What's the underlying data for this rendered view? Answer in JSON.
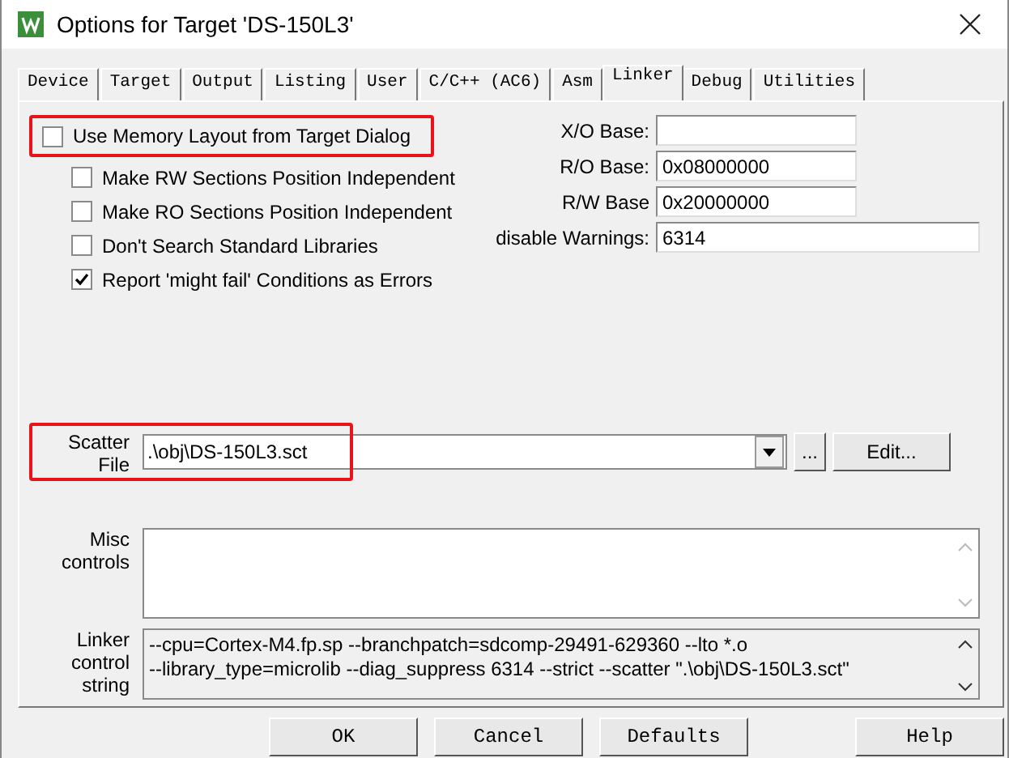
{
  "window": {
    "title": "Options for Target 'DS-150L3'"
  },
  "tabs": [
    {
      "label": "Device",
      "selected": false
    },
    {
      "label": "Target",
      "selected": false
    },
    {
      "label": "Output",
      "selected": false
    },
    {
      "label": "Listing",
      "selected": false
    },
    {
      "label": "User",
      "selected": false
    },
    {
      "label": "C/C++ (AC6)",
      "selected": false
    },
    {
      "label": "Asm",
      "selected": false
    },
    {
      "label": "Linker",
      "selected": true
    },
    {
      "label": "Debug",
      "selected": false
    },
    {
      "label": "Utilities",
      "selected": false
    }
  ],
  "options": [
    {
      "label": "Use Memory Layout from Target Dialog",
      "checked": false,
      "highlighted": true,
      "kind": "main"
    },
    {
      "label": "Make RW Sections Position Independent",
      "checked": false,
      "highlighted": false,
      "kind": "sub"
    },
    {
      "label": "Make RO Sections Position Independent",
      "checked": false,
      "highlighted": false,
      "kind": "sub"
    },
    {
      "label": "Don't Search Standard Libraries",
      "checked": false,
      "highlighted": false,
      "kind": "sub"
    },
    {
      "label": "Report 'might fail' Conditions as Errors",
      "checked": true,
      "highlighted": false,
      "kind": "sub"
    }
  ],
  "bases": [
    {
      "label": "X/O Base:",
      "kind": "short"
    },
    {
      "label": "R/O Base:",
      "value": "0x08000000",
      "kind": "short"
    },
    {
      "label": "R/W Base",
      "value": "0x20000000",
      "kind": "short"
    },
    {
      "label": "disable Warnings:",
      "value": "6314",
      "kind": "wide"
    }
  ],
  "scatter_file": {
    "label": "Scatter File",
    "value": ".\\obj\\DS-150L3.sct",
    "highlighted": true,
    "browse_button": "...",
    "edit_button": "Edit..."
  },
  "misc_controls": {
    "label": "Misc controls"
  },
  "linker_control_string": {
    "label": "Linker control string",
    "lines": [
      "--cpu=Cortex-M4.fp.sp --branchpatch=sdcomp-29491-629360 --lto *.o",
      "--library_type=microlib --diag_suppress 6314 --strict --scatter \".\\obj\\DS-150L3.sct\""
    ]
  },
  "buttons": [
    {
      "label": "OK"
    },
    {
      "label": "Cancel"
    },
    {
      "label": "Defaults"
    },
    {
      "label": "Help"
    }
  ]
}
